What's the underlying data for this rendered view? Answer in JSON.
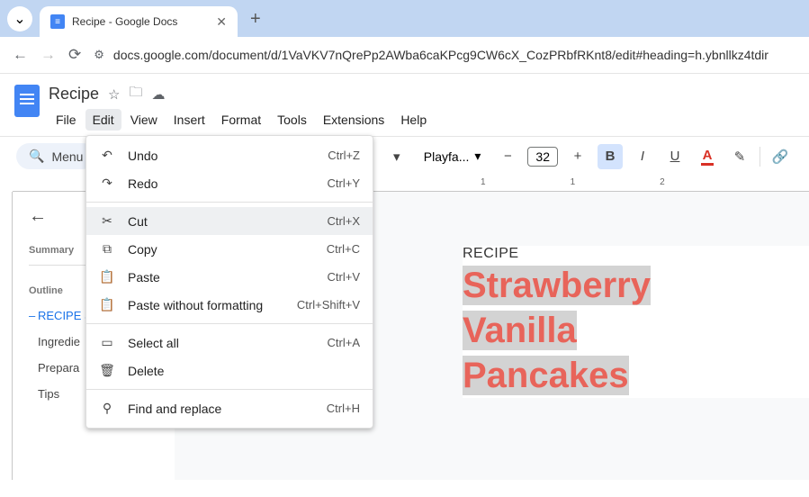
{
  "browser": {
    "tab_title": "Recipe - Google Docs",
    "url": "docs.google.com/document/d/1VaVKV7nQrePp2AWba6caKPcg9CW6cX_CozPRbfRKnt8/edit#heading=h.ybnllkz4tdir"
  },
  "doc": {
    "title": "Recipe",
    "menu": [
      "File",
      "Edit",
      "View",
      "Insert",
      "Format",
      "Tools",
      "Extensions",
      "Help"
    ],
    "active_menu_index": 1
  },
  "toolbar": {
    "search_label": "Menu",
    "font_name": "Playfa...",
    "font_size": "32"
  },
  "ruler": {
    "marks": [
      "1",
      "1",
      "2"
    ]
  },
  "outline": {
    "summary_label": "Summary",
    "outline_label": "Outline",
    "items": [
      {
        "label": "RECIPE S",
        "selected": true
      },
      {
        "label": "Ingredie",
        "selected": false
      },
      {
        "label": "Prepara",
        "selected": false
      },
      {
        "label": "Tips",
        "selected": false
      }
    ]
  },
  "page": {
    "eyebrow": "RECIPE",
    "title_lines": [
      "Strawberry",
      "Vanilla",
      "Pancakes"
    ]
  },
  "edit_menu": {
    "items": [
      {
        "icon": "↶",
        "label": "Undo",
        "shortcut": "Ctrl+Z",
        "name": "undo"
      },
      {
        "icon": "↷",
        "label": "Redo",
        "shortcut": "Ctrl+Y",
        "name": "redo"
      },
      {
        "sep": true
      },
      {
        "icon": "✂",
        "label": "Cut",
        "shortcut": "Ctrl+X",
        "name": "cut",
        "highlighted": true
      },
      {
        "icon": "⧉",
        "label": "Copy",
        "shortcut": "Ctrl+C",
        "name": "copy"
      },
      {
        "icon": "📋",
        "label": "Paste",
        "shortcut": "Ctrl+V",
        "name": "paste"
      },
      {
        "icon": "📋",
        "label": "Paste without formatting",
        "shortcut": "Ctrl+Shift+V",
        "name": "paste-no-format"
      },
      {
        "sep": true
      },
      {
        "icon": "▭",
        "label": "Select all",
        "shortcut": "Ctrl+A",
        "name": "select-all"
      },
      {
        "icon": "🗑",
        "label": "Delete",
        "shortcut": "",
        "name": "delete"
      },
      {
        "sep": true
      },
      {
        "icon": "⚲",
        "label": "Find and replace",
        "shortcut": "Ctrl+H",
        "name": "find-replace"
      }
    ]
  }
}
